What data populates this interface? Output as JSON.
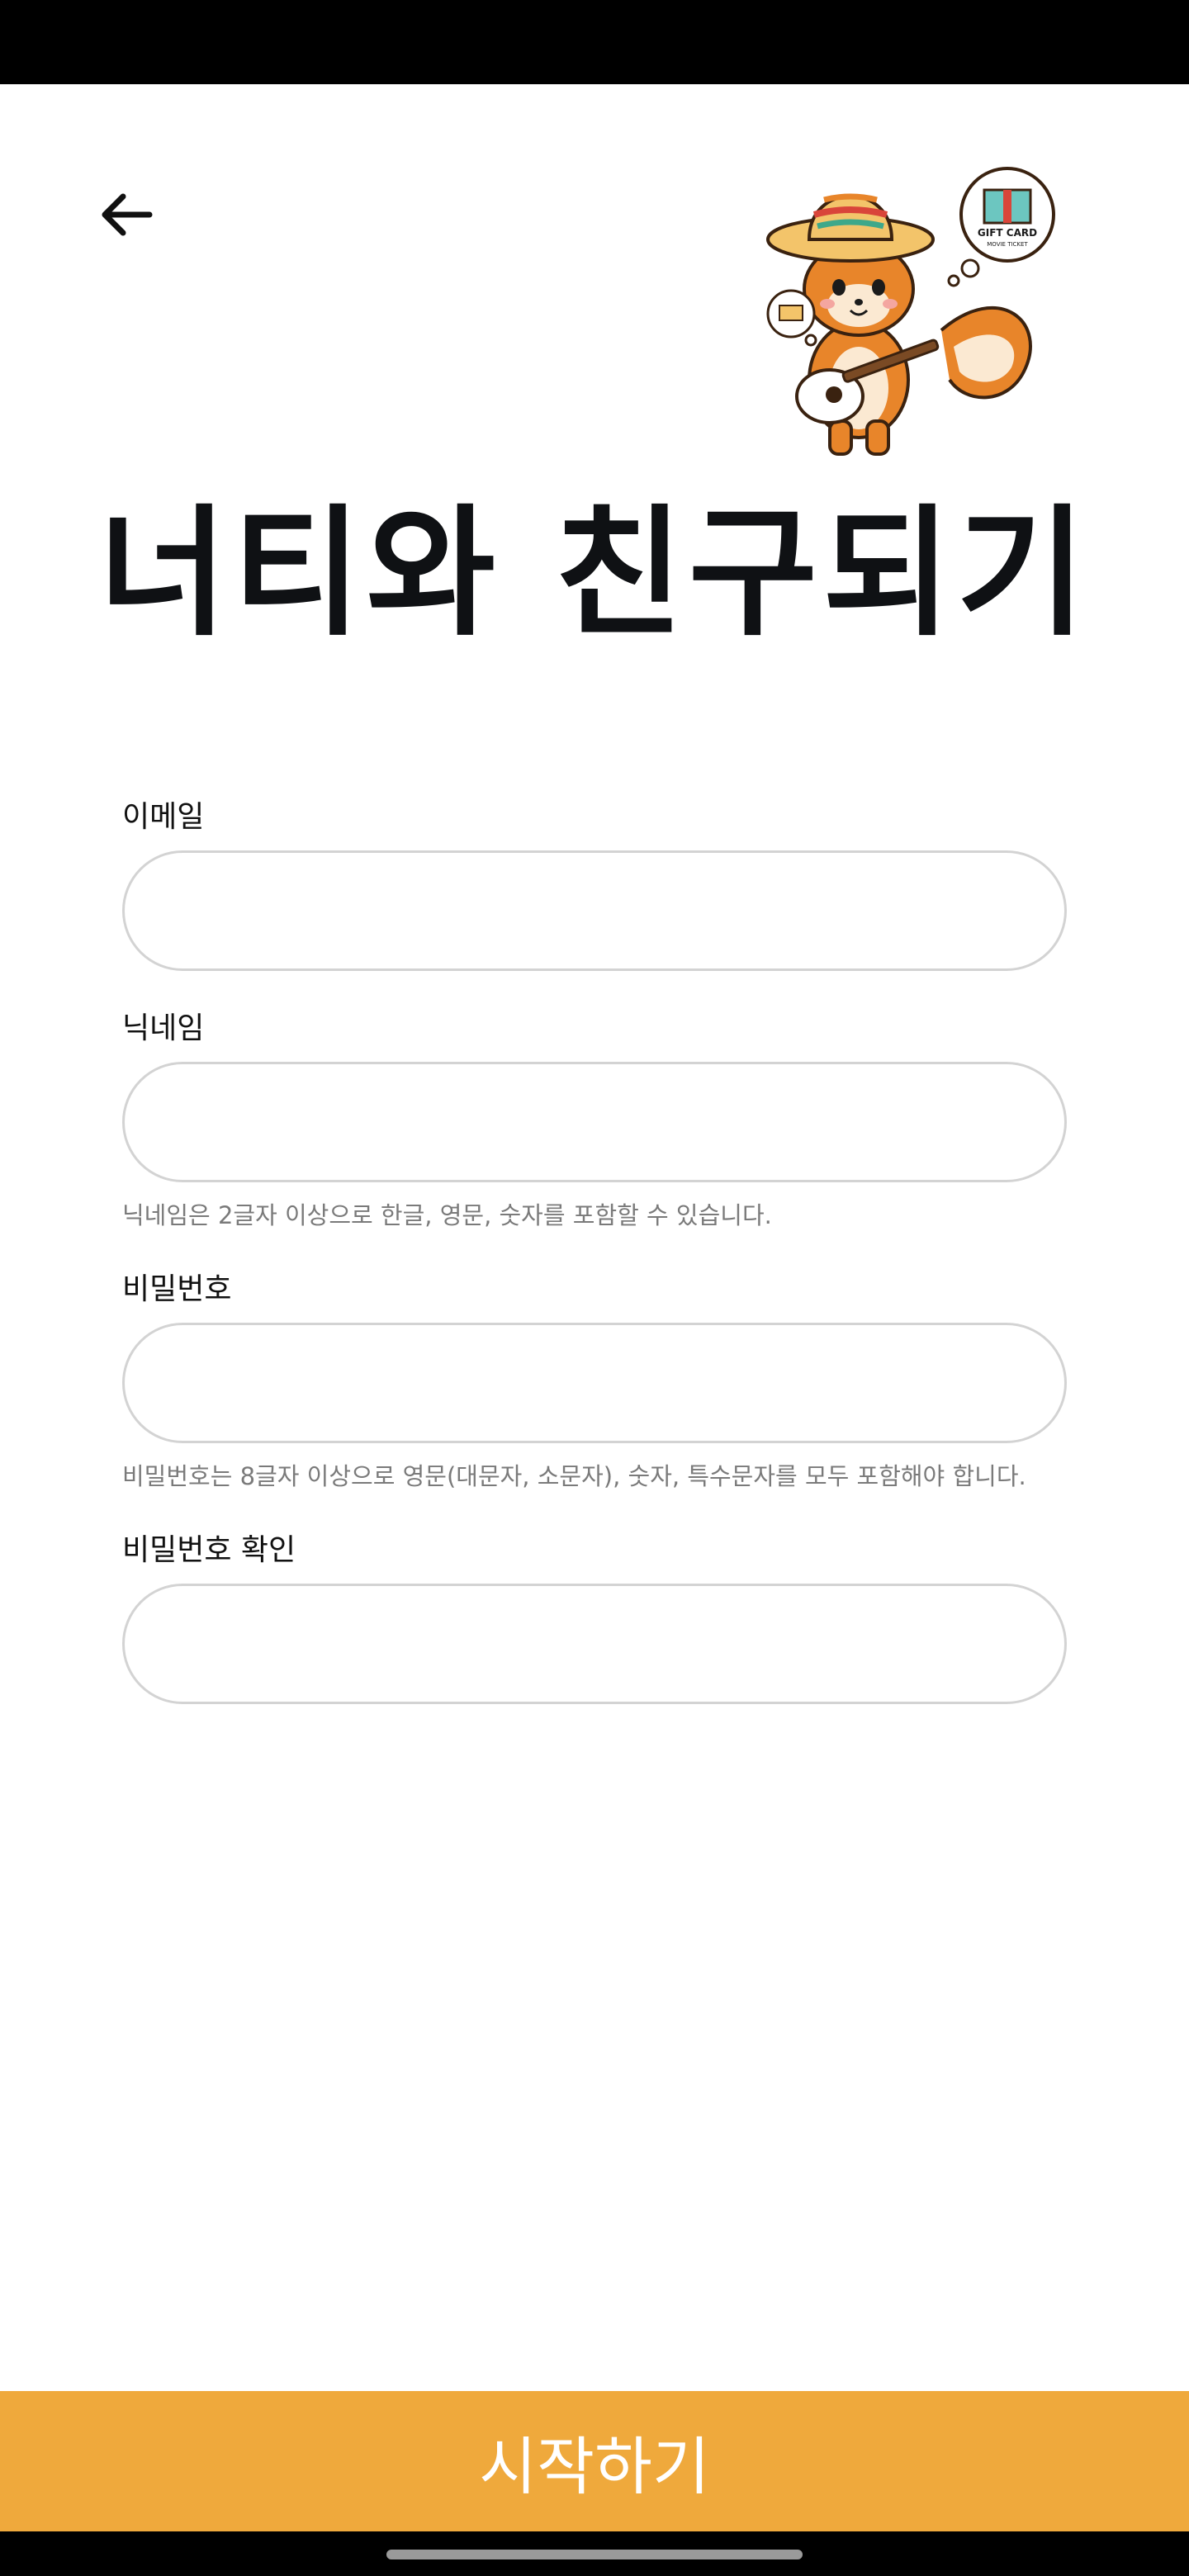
{
  "header": {
    "back_icon": "arrow-left-icon",
    "mascot": {
      "description_icon": "squirrel-mascot-icon",
      "bubble_text_top": "GIFT CARD",
      "bubble_text_bottom": "MOVIE TICKET"
    }
  },
  "title": "너티와 친구되기",
  "form": {
    "email": {
      "label": "이메일",
      "value": "",
      "placeholder": ""
    },
    "nickname": {
      "label": "닉네임",
      "value": "",
      "placeholder": "",
      "hint": "닉네임은 2글자 이상으로 한글, 영문, 숫자를 포함할 수 있습니다."
    },
    "password": {
      "label": "비밀번호",
      "value": "",
      "placeholder": "",
      "hint": "비밀번호는 8글자 이상으로 영문(대문자, 소문자), 숫자, 특수문자를 모두 포함해야 합니다."
    },
    "password_confirm": {
      "label": "비밀번호 확인",
      "value": "",
      "placeholder": ""
    }
  },
  "start_button": {
    "label": "시작하기"
  },
  "colors": {
    "accent": "#efa93c",
    "input_border": "#d3d3d3",
    "hint_text": "#7a7a7a",
    "title_text": "#0f1114"
  }
}
